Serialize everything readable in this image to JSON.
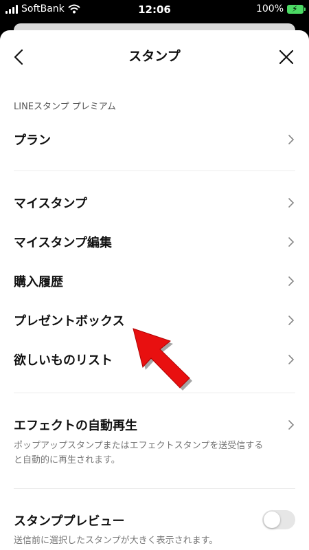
{
  "status_bar": {
    "carrier": "SoftBank",
    "time": "12:06",
    "battery": "100%"
  },
  "header": {
    "title": "スタンプ"
  },
  "premium_section": {
    "label": "LINEスタンプ プレミアム",
    "items": [
      {
        "label": "プラン"
      }
    ]
  },
  "stamp_section": {
    "items": [
      {
        "label": "マイスタンプ"
      },
      {
        "label": "マイスタンプ編集"
      },
      {
        "label": "購入履歴"
      },
      {
        "label": "プレゼントボックス"
      },
      {
        "label": "欲しいものリスト"
      }
    ]
  },
  "effect_section": {
    "label": "エフェクトの自動再生",
    "description_line1": "ポップアップスタンプまたはエフェクトスタンプを送受信する",
    "description_line2": "と自動的に再生されます。"
  },
  "preview_section": {
    "label": "スタンププレビュー",
    "description": "送信前に選択したスタンプが大きく表示されます。",
    "toggle_on": false
  },
  "colors": {
    "accent_arrow": "#e81010",
    "battery": "#4cd964"
  }
}
